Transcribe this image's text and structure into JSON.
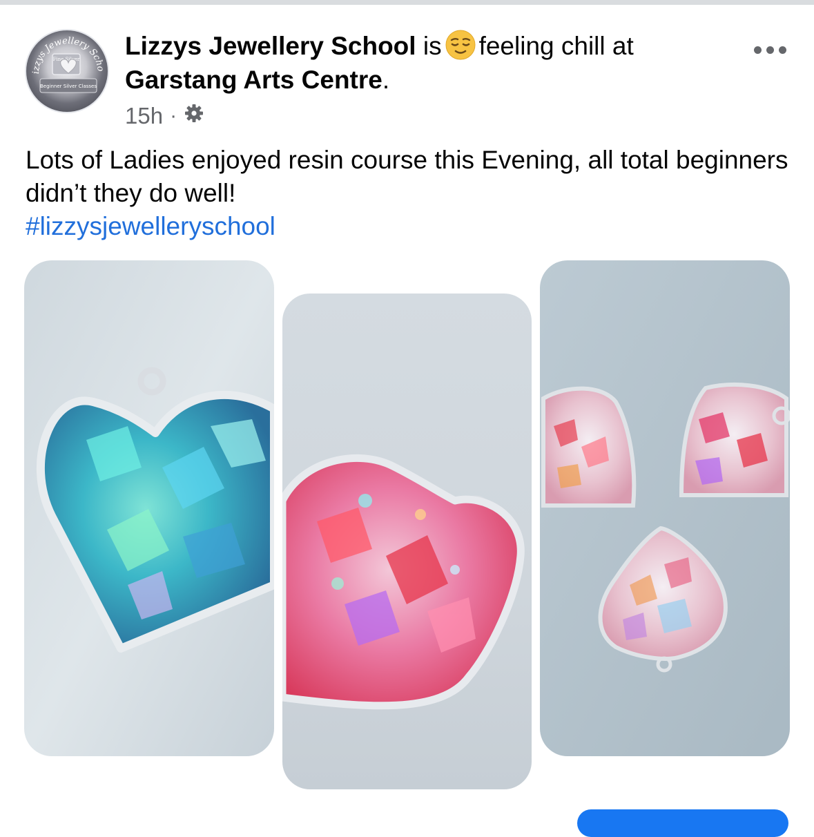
{
  "post": {
    "author": "Lizzys Jewellery School",
    "is_text": "is",
    "feeling": "feeling chill at",
    "place": "Garstang Arts Centre",
    "period": ".",
    "time": "15h",
    "separator": "·",
    "privacy_icon": "gear-icon",
    "message": "Lots of Ladies enjoyed resin course this Evening, all  total beginners didn’t they do well!",
    "hashtag": "#lizzysjewelleryschool",
    "photos": [
      {
        "subject": "blue-heart-pendant"
      },
      {
        "subject": "pink-heart-pendant"
      },
      {
        "subject": "three-heart-pendants"
      }
    ]
  },
  "avatar": {
    "logo_text": "Lizzys Jewellery School",
    "logo_subtext": "Fine Silver",
    "logo_caption": "Beginner Silver Classes"
  },
  "colors": {
    "link": "#216fdb",
    "secondary_text": "#65676b",
    "primary_button": "#1877f2"
  }
}
